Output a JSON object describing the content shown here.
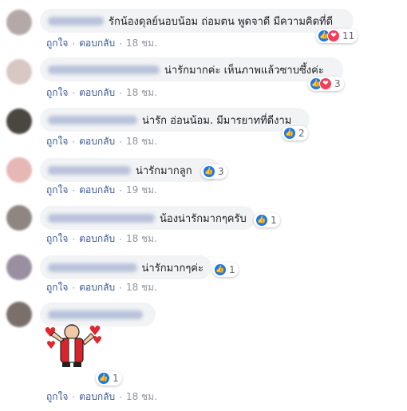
{
  "comments": [
    {
      "text": "รักน้องดุลย์นอบน้อม ถ่อมตน พูดจาดี มีความคิดที่ดี",
      "count": "11",
      "like": "ถูกใจ",
      "reply": "ตอบกลับ",
      "time": "18 ชม."
    },
    {
      "text": "น่ารักมากค่ะ เห็นภาพแล้วซาบซึ้งค่ะ",
      "count": "3",
      "like": "ถูกใจ",
      "reply": "ตอบกลับ",
      "time": "18 ชม."
    },
    {
      "text": "น่ารัก อ่อนน้อม. มีมารยาทที่ดีงาม",
      "count": "2",
      "like": "ถูกใจ",
      "reply": "ตอบกลับ",
      "time": "18 ชม."
    },
    {
      "text": "น่ารักมากลูก",
      "count": "3",
      "like": "ถูกใจ",
      "reply": "ตอบกลับ",
      "time": "19 ชม."
    },
    {
      "text": "น้องน่ารักมากๆครับ",
      "count": "1",
      "like": "ถูกใจ",
      "reply": "ตอบกลับ",
      "time": "18 ชม."
    },
    {
      "text": "น่ารักมากๆค่ะ",
      "count": "1",
      "like": "ถูกใจ",
      "reply": "ตอบกลับ",
      "time": "18 ชม."
    },
    {
      "text": "",
      "count": "1",
      "like": "ถูกใจ",
      "reply": "ตอบกลับ",
      "time": "18 ชม."
    }
  ],
  "separator": "·",
  "icons": {
    "like": "thumbs-up-icon",
    "love": "heart-icon"
  },
  "colors": {
    "link": "#385898",
    "bubble": "#f2f3f5",
    "like": "#1877f2",
    "love": "#f33e58",
    "muted": "#90949c"
  }
}
